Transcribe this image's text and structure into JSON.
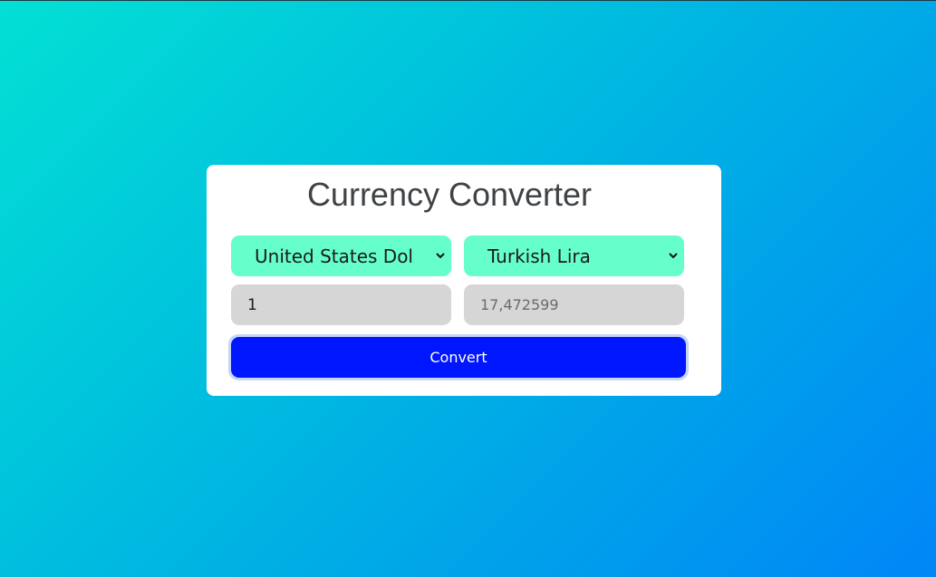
{
  "title": "Currency Converter",
  "from_currency": {
    "selected": "United States Dollar"
  },
  "to_currency": {
    "selected": "Turkish Lira"
  },
  "amount_input": {
    "value": "1"
  },
  "result_field": {
    "value": "17,472599"
  },
  "convert_button": {
    "label": "Convert"
  },
  "colors": {
    "select_bg": "#66fecb",
    "field_bg": "#d6d6d6",
    "button_bg": "#0016ff",
    "card_bg": "#ffffff"
  }
}
